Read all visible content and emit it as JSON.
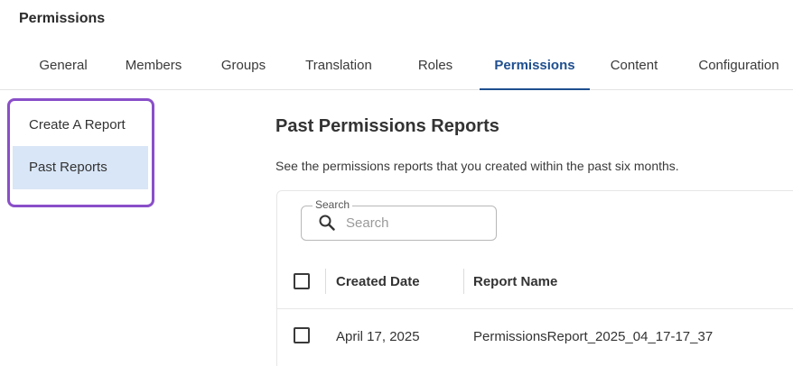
{
  "page": {
    "title": "Permissions"
  },
  "tabs": [
    {
      "label": "General"
    },
    {
      "label": "Members"
    },
    {
      "label": "Groups"
    },
    {
      "label": "Translation"
    },
    {
      "label": "Roles"
    },
    {
      "label": "Permissions",
      "active": true
    },
    {
      "label": "Content"
    },
    {
      "label": "Configuration"
    }
  ],
  "sidebar": {
    "items": [
      {
        "label": "Create A Report"
      },
      {
        "label": "Past Reports",
        "selected": true
      }
    ],
    "highlight_color": "#8a4fc9"
  },
  "main": {
    "title": "Past Permissions Reports",
    "description": "See the permissions reports that you created within the past six months.",
    "search": {
      "legend": "Search",
      "placeholder": "Search",
      "value": ""
    },
    "table": {
      "columns": [
        "Created Date",
        "Report Name"
      ],
      "rows": [
        {
          "created_date": "April 17, 2025",
          "report_name": "PermissionsReport_2025_04_17-17_37"
        }
      ]
    }
  },
  "colors": {
    "accent": "#1f4f8f",
    "selected_bg": "#d9e6f7"
  }
}
